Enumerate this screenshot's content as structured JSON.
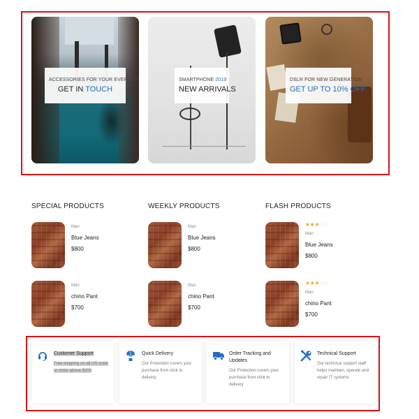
{
  "banners": [
    {
      "line1": "ACCESSORIES FOR YOUR EVERYDAY",
      "line2_plain": "GET IN ",
      "line2_accent": "TOUCH"
    },
    {
      "line1_plain": "SMARTPHONE ",
      "line1_accent": "2019",
      "line2": "NEW ARRIVALS"
    },
    {
      "line1": "DSLR FOR NEW GENERATION",
      "line2": "GET UP TO 10% OFF"
    }
  ],
  "sections": [
    {
      "title": "SPECIAL PRODUCTS",
      "products": [
        {
          "category": "Man",
          "name": "Blue Jeans",
          "price": "$800"
        },
        {
          "category": "Man",
          "name": "chino Pant",
          "price": "$700"
        }
      ]
    },
    {
      "title": "WEEKLY PRODUCTS",
      "products": [
        {
          "category": "Man",
          "name": "Blue Jeans",
          "price": "$800"
        },
        {
          "category": "Man",
          "name": "chino Pant",
          "price": "$700"
        }
      ]
    },
    {
      "title": "FLASH PRODUCTS",
      "products": [
        {
          "category": "Man",
          "name": "Blue Jeans",
          "price": "$800",
          "rating": 3,
          "rating_max": 5
        },
        {
          "category": "Man",
          "name": "chino Pant",
          "price": "$700",
          "rating": 3,
          "rating_max": 5
        }
      ]
    }
  ],
  "services": [
    {
      "icon": "headset-icon",
      "title": "Customer Support",
      "desc": "Free shipping on all US order or order above $200"
    },
    {
      "icon": "balloon-icon",
      "title": "Quick Delivery",
      "desc": "Our Protection covers your purchase from click to delivery"
    },
    {
      "icon": "truck-icon",
      "title": "Order Tracking and Updates",
      "desc": "Our Protection covers your purchase from click to delivery"
    },
    {
      "icon": "tools-icon",
      "title": "Technical Support",
      "desc": "Our technical support staff helps maintain, operate and repair IT systems"
    }
  ],
  "colors": {
    "accent": "#1f6fc7",
    "annotation": "#e01010",
    "star": "#f5a623"
  }
}
